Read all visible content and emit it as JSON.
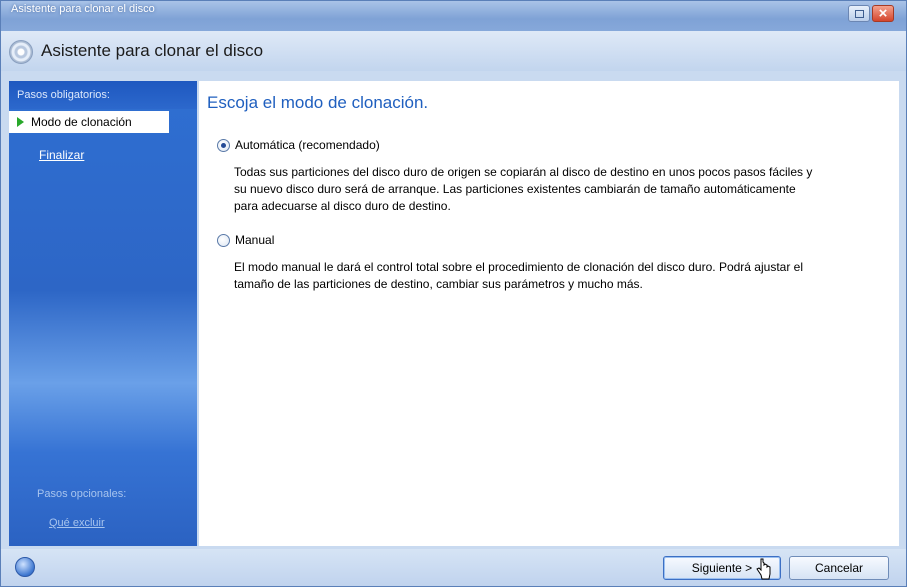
{
  "window": {
    "title": "Asistente para clonar el disco",
    "header_title": "Asistente para clonar el disco"
  },
  "sidebar": {
    "required_heading": "Pasos obligatorios:",
    "steps": [
      {
        "label": "Modo de clonación",
        "state": "current"
      },
      {
        "label": "Finalizar",
        "state": "link"
      }
    ],
    "optional_heading": "Pasos opcionales:",
    "optional_link": "Qué excluir"
  },
  "main": {
    "heading": "Escoja el modo de clonación.",
    "options": [
      {
        "label": "Automática (recomendado)",
        "selected": true,
        "description_lines": [
          "Todas sus particiones del disco duro de origen se copiarán al disco de destino en unos pocos pasos fáciles y",
          "su nuevo disco duro será de arranque. Las particiones existentes cambiarán de tamaño automáticamente",
          "para adecuarse al disco duro de destino."
        ]
      },
      {
        "label": "Manual",
        "selected": false,
        "description_lines": [
          "El modo manual le dará el control total sobre el procedimiento de clonación del disco duro. Podrá ajustar el",
          "tamaño de las particiones de destino, cambiar sus parámetros y mucho más."
        ]
      }
    ]
  },
  "footer": {
    "next_label": "Siguiente >",
    "cancel_label": "Cancelar"
  },
  "icons": {
    "app": "disc-icon",
    "help": "help-icon",
    "step_arrow": "green-arrow-icon",
    "restore": "restore-icon",
    "close": "close-icon",
    "cursor": "hand-cursor-icon"
  },
  "colors": {
    "sidebar": "#2f6fd2",
    "heading": "#1f5fbf",
    "titlebar": "#7fa2d6",
    "close_button": "#d4452c"
  }
}
